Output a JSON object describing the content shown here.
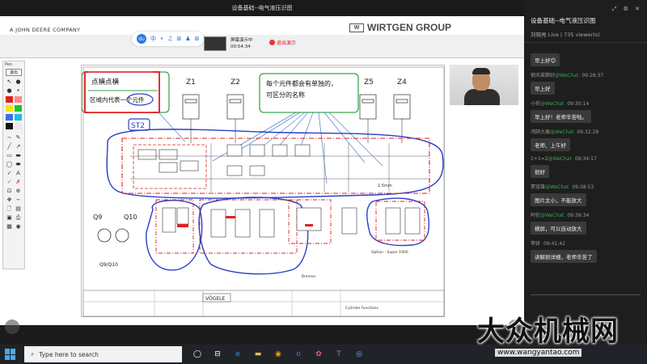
{
  "app": {
    "window_title": "设备基础--电气液压识图",
    "window_controls": "— ☐ ✕"
  },
  "stage": {
    "company_left": "A JOHN DEERE COMPANY",
    "company_right": "WIRTGEN GROUP",
    "share_label": "屏幕演示中",
    "share_time": "00:54:34",
    "stop_label": "退出演示",
    "pill_items": [
      "du",
      "中",
      "•",
      "♫",
      "⊞",
      "♟",
      "⊞"
    ]
  },
  "tools": {
    "title": "Pen",
    "exit": "退出",
    "colors": [
      "#e02020",
      "#ff8a80",
      "#f2e600",
      "#23c12e",
      "#3b6ee8",
      "#16c2e0",
      "#111111",
      "#e8e8e8"
    ]
  },
  "slide": {
    "note_left_line1": "点横点横",
    "note_left_line2": "区域内代表一个元件",
    "note_right_line1": "每个元件都会有单独的，",
    "note_right_line2": "可区分的名称",
    "labels_top": [
      "Z1",
      "Z2",
      "Z5",
      "Z4"
    ],
    "label_st2": "ST2",
    "label_q9": "Q9",
    "label_q10": "Q10",
    "label_q9q10": "Q9/Q10",
    "label_option": "Option - Super 1900",
    "label_rumbe": "Bremse",
    "label_title_block": "Cylinder functions",
    "label_vogele": "VÖGELE"
  },
  "panel": {
    "title": "设备基础--电气液压识图",
    "subtitle": "刘晓亮 Live | 735 viewer(s)",
    "controls": "⤢ ⚙ ✕",
    "messages": [
      {
        "user": "",
        "src": "",
        "time": "",
        "text": "早上好😊"
      },
      {
        "user": "钢天菜鹅好",
        "src": "@WeChat",
        "time": "09:28:37",
        "text": "早上好"
      },
      {
        "user": "小祈",
        "src": "@WeChat",
        "time": "09:30:14",
        "text": "早上好！老师辛苦啦。"
      },
      {
        "user": "鸿鹄大展",
        "src": "@WeChat",
        "time": "09:32:28",
        "text": "老师、上午好"
      },
      {
        "user": "1+1=2",
        "src": "@WeChat",
        "time": "09:34:17",
        "text": "很好"
      },
      {
        "user": "寥寇雄",
        "src": "@WeChat",
        "time": "09:38:53",
        "text": "图片太小，不能放大"
      },
      {
        "user": "阿伦",
        "src": "@WeChat",
        "time": "09:39:34",
        "text": "横屏，可以自动放大"
      },
      {
        "user": "李妍",
        "src": "",
        "time": "09:41:42",
        "text": "讲解很详细，老师辛苦了"
      }
    ]
  },
  "taskbar": {
    "search_placeholder": "Type here to search"
  },
  "watermark": {
    "brand": "大众机械网",
    "url": "www.wangyantao.com"
  }
}
